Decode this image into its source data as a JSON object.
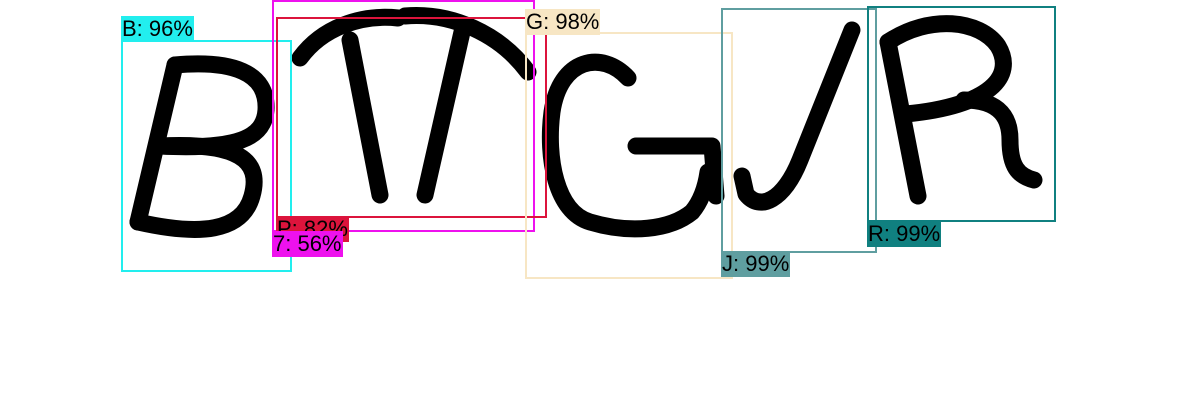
{
  "captcha": {
    "text": "BTTGJR",
    "stroke_color": "#000000",
    "background_color": "#ffffff"
  },
  "detections": [
    {
      "id": "b",
      "label": "B: 96%",
      "color": "#22eeee"
    },
    {
      "id": "7",
      "label": "7: 56%",
      "color": "#ee11ee"
    },
    {
      "id": "p",
      "label": "P: 82%",
      "color": "#dc143c"
    },
    {
      "id": "g",
      "label": "G: 98%",
      "color": "#f7e6c4"
    },
    {
      "id": "j",
      "label": "J: 99%",
      "color": "#5f9ea0"
    },
    {
      "id": "r",
      "label": "R: 99%",
      "color": "#108080"
    }
  ]
}
